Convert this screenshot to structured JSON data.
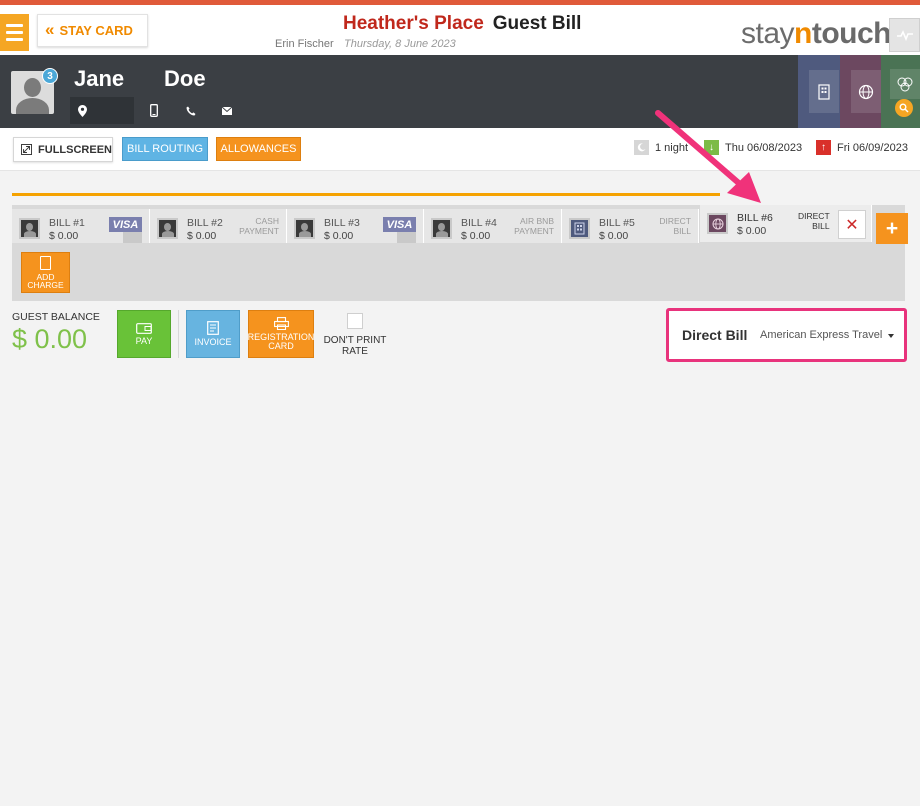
{
  "header": {
    "stay_card_label": "STAY CARD",
    "hotel_name": "Heather's Place",
    "page_title": "Guest Bill",
    "user_name": "Erin Fischer",
    "date": "Thursday, 8 June 2023",
    "logo_pre": "stay",
    "logo_n": "n",
    "logo_post": "touch"
  },
  "guest": {
    "first_name": "Jane",
    "last_name": "Doe",
    "badge_count": "3"
  },
  "toolbar": {
    "fullscreen_label": "FULLSCREEN",
    "bill_routing_label": "BILL ROUTING",
    "allowances_label": "ALLOWANCES",
    "nights": "1 night",
    "arrival": "Thu 06/08/2023",
    "departure": "Fri 06/09/2023"
  },
  "bills": [
    {
      "label": "BILL #1",
      "amount": "$ 0.00",
      "type": "VISA",
      "visa": true
    },
    {
      "label": "BILL #2",
      "amount": "$ 0.00",
      "type_line1": "CASH",
      "type_line2": "PAYMENT"
    },
    {
      "label": "BILL #3",
      "amount": "$ 0.00",
      "type": "VISA",
      "visa": true
    },
    {
      "label": "BILL #4",
      "amount": "$ 0.00",
      "type_line1": "AIR BNB",
      "type_line2": "PAYMENT"
    },
    {
      "label": "BILL #5",
      "amount": "$ 0.00",
      "type_line1": "DIRECT",
      "type_line2": "BILL"
    },
    {
      "label": "BILL #6",
      "amount": "$ 0.00",
      "type_line1": "DIRECT",
      "type_line2": "BILL"
    }
  ],
  "add_charge_line1": "ADD",
  "add_charge_line2": "CHARGE",
  "add_bill_symbol": "+",
  "close_symbol": "✕",
  "balance": {
    "label": "GUEST BALANCE",
    "value": "$ 0.00"
  },
  "actions": {
    "pay_label": "PAY",
    "invoice_label": "INVOICE",
    "reg_card_line1": "REGISTRATION",
    "reg_card_line2": "CARD",
    "dont_print_line1": "DON'T PRINT",
    "dont_print_line2": "RATE"
  },
  "direct_bill": {
    "label": "Direct Bill",
    "selected": "American Express Travel"
  },
  "colors": {
    "accent_orange": "#f5931e",
    "hotel_red": "#c0281c",
    "highlight_pink": "#e8337c",
    "balance_green": "#7fc14a"
  }
}
